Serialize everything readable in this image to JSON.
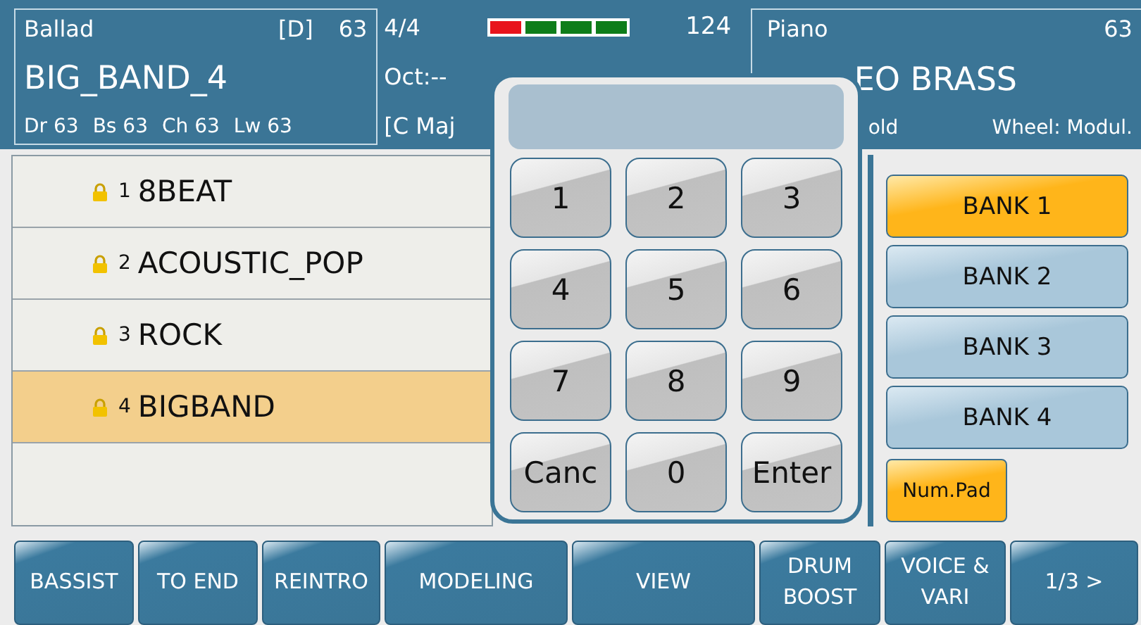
{
  "style_panel": {
    "category": "Ballad",
    "mode": "[D]",
    "volume": "63",
    "name": "BIG_BAND_4",
    "parts": [
      "Dr 63",
      "Bs 63",
      "Ch 63",
      "Lw 63"
    ]
  },
  "status": {
    "time_signature": "4/4",
    "octave": "Oct:--",
    "chord": "[C Maj",
    "tempo": "124"
  },
  "beat_meter": [
    {
      "color": "#e8141c"
    },
    {
      "color": "#0e7d1a"
    },
    {
      "color": "#0e7d1a"
    },
    {
      "color": "#0e7d1a"
    }
  ],
  "voice_panel": {
    "category": "Piano",
    "volume": "63",
    "name": "EO BRASS",
    "pedal": "old",
    "wheel": "Wheel: Modul."
  },
  "style_list": [
    {
      "number": "1",
      "name": "8BEAT",
      "selected": false
    },
    {
      "number": "2",
      "name": "ACOUSTIC_POP",
      "selected": false
    },
    {
      "number": "3",
      "name": "ROCK",
      "selected": false
    },
    {
      "number": "4",
      "name": "BIGBAND",
      "selected": true
    }
  ],
  "banks": [
    {
      "label": "BANK 1",
      "selected": true
    },
    {
      "label": "BANK 2",
      "selected": false
    },
    {
      "label": "BANK 3",
      "selected": false
    },
    {
      "label": "BANK 4",
      "selected": false
    }
  ],
  "numpad_toggle": {
    "label": "Num.Pad",
    "on": true
  },
  "numpad": {
    "keys": [
      "1",
      "2",
      "3",
      "4",
      "5",
      "6",
      "7",
      "8",
      "9",
      "Canc",
      "0",
      "Enter"
    ]
  },
  "function_buttons": [
    {
      "label": "BASSIST"
    },
    {
      "label": "TO END"
    },
    {
      "label": "REINTRO"
    },
    {
      "label": "MODELING"
    },
    {
      "label": "VIEW"
    },
    {
      "label": "DRUM BOOST"
    },
    {
      "label": "VOICE & VARI"
    },
    {
      "label": "1/3 >"
    }
  ]
}
